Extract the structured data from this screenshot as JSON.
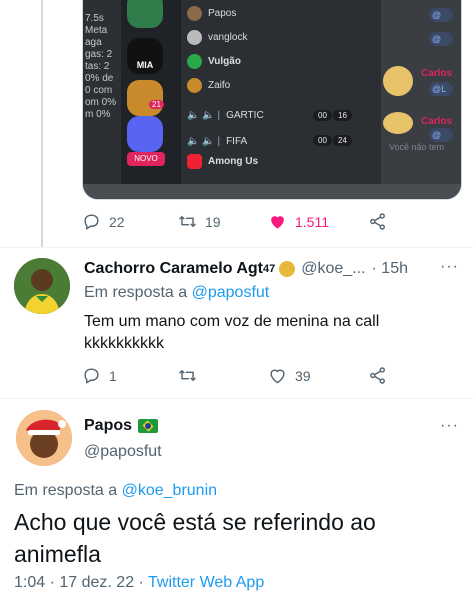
{
  "media": {
    "left_lines": [
      "7.5s",
      "Meta",
      "aga",
      "gas: 2",
      "tas: 2",
      "0% de",
      "0 com",
      "om 0%",
      "m 0%"
    ],
    "server_label": "MIA",
    "new_label": "NOVO",
    "badge": "21",
    "channel_users": [
      "Papos",
      "vanglock",
      "Vulgão",
      "Zaifo"
    ],
    "voice_channels": [
      "GARTIC",
      "FIFA",
      "Among Us"
    ],
    "counts": [
      "00",
      "16",
      "00",
      "24"
    ],
    "right_names": [
      "Carlos",
      "Carlos"
    ],
    "right_handles": [
      "@",
      "@",
      "@L",
      "@"
    ],
    "right_status": "Você não tem"
  },
  "top_actions": {
    "replies": "22",
    "retweets": "19",
    "likes": "1.511"
  },
  "reply1": {
    "name": "Cachorro Caramelo Agt",
    "sup": "47",
    "handle": "@koe_...",
    "time": "· 15h",
    "reply_prefix": "Em resposta a",
    "reply_to": "@paposfut",
    "text_line1": "Tem um mano com voz de menina na call",
    "text_line2": "kkkkkkkkkk",
    "replies": "1",
    "retweets": "",
    "likes": "39"
  },
  "main": {
    "name": "Papos",
    "handle": "@paposfut",
    "reply_prefix": "Em resposta a",
    "reply_to": "@koe_brunin",
    "text_line1": "Acho que você está se referindo ao",
    "text_line2": "animefla",
    "time": "1:04 · 17 dez. 22 ·",
    "source": "Twitter Web App"
  },
  "colors": {
    "blue": "#1d9bf0",
    "like_pink": "#f91880",
    "muted": "#536471"
  }
}
